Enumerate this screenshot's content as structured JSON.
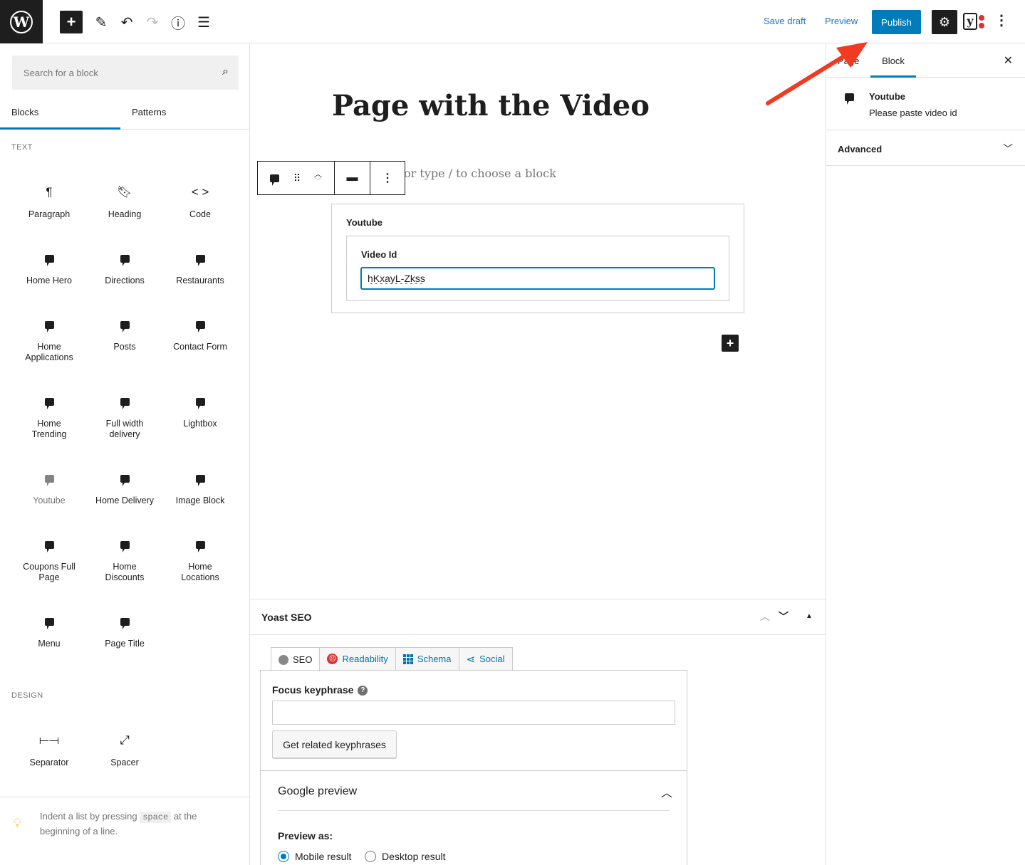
{
  "topbar": {
    "save_draft": "Save draft",
    "preview": "Preview",
    "publish": "Publish"
  },
  "inserter": {
    "search_placeholder": "Search for a block",
    "tabs": [
      "Blocks",
      "Patterns"
    ],
    "categories": {
      "text": "TEXT",
      "design": "DESIGN"
    },
    "text_blocks": [
      "Paragraph",
      "Heading",
      "Code",
      "Home Hero",
      "Directions",
      "Restaurants",
      "Home Applications",
      "Posts",
      "Contact Form",
      "Home Trending",
      "Full width delivery",
      "Lightbox",
      "Youtube",
      "Home Delivery",
      "Image Block",
      "Coupons Full Page",
      "Home Discounts",
      "Home Locations",
      "Menu",
      "Page Title"
    ],
    "design_blocks": [
      "Separator",
      "Spacer"
    ],
    "tip": {
      "before": "Indent a list by pressing ",
      "key": "space",
      "after": " at the beginning of a line."
    }
  },
  "canvas": {
    "title": "Page with the Video",
    "placeholder": "or type / to choose a block",
    "youtube_block": {
      "label": "Youtube",
      "field_label": "Video Id",
      "field_value": "hKxayL-Zkss"
    }
  },
  "yoast": {
    "title": "Yoast SEO",
    "tabs": [
      "SEO",
      "Readability",
      "Schema",
      "Social"
    ],
    "focus_keyphrase": "Focus keyphrase",
    "related_button": "Get related keyphrases",
    "google_preview": "Google preview",
    "preview_as": "Preview as:",
    "mobile_result": "Mobile result",
    "desktop_result": "Desktop result"
  },
  "sidebar": {
    "tabs": [
      "Page",
      "Block"
    ],
    "block_name": "Youtube",
    "block_desc": "Please paste video id",
    "advanced": "Advanced"
  },
  "colors": {
    "accent": "#007cba",
    "dark": "#1e1e1e",
    "annotation_arrow": "#f03a22"
  },
  "icons": {
    "logo": "wordpress-logo-icon",
    "add": "plus-icon",
    "edit": "pencil-icon",
    "undo": "undo-icon",
    "redo": "redo-icon",
    "info": "info-icon",
    "list_view": "list-view-icon",
    "settings": "gear-icon",
    "yoast": "yoast-icon",
    "more": "kebab-icon"
  }
}
